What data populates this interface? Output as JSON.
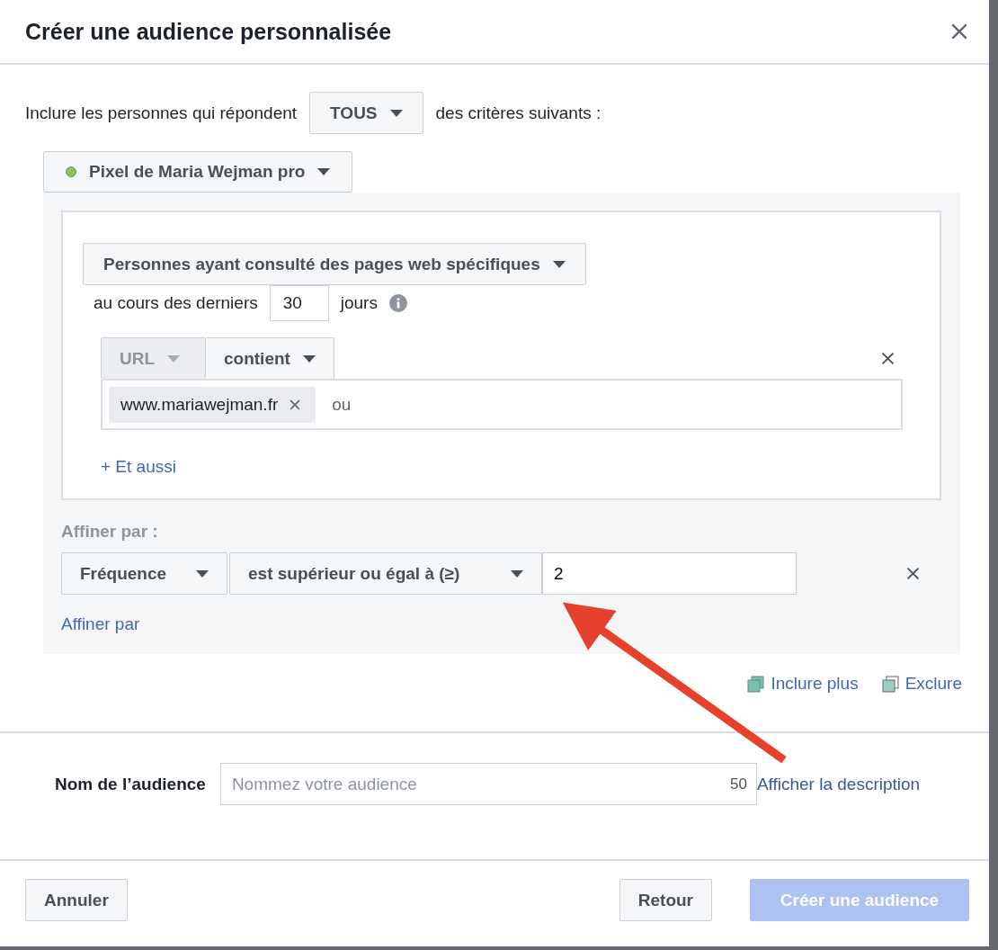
{
  "dialog": {
    "title": "Créer une audience personnalisée"
  },
  "match_rule": {
    "prefix": "Inclure les personnes qui répondent",
    "value": "TOUS",
    "suffix": "des critères suivants :"
  },
  "source": {
    "label": "Pixel de Maria Wejman pro",
    "active": true
  },
  "rule": {
    "event": "Personnes ayant consulté des pages web spécifiques",
    "period_prefix": "au cours des derniers",
    "days": "30",
    "period_suffix": "jours",
    "conditions": [
      {
        "field": "URL",
        "field_disabled": true,
        "operator": "contient",
        "tags": [
          "www.mariawejman.fr"
        ],
        "placeholder": "ou"
      }
    ],
    "add_link": "+ Et aussi"
  },
  "refine": {
    "heading": "Affiner par :",
    "filters": [
      {
        "metric": "Fréquence",
        "operator": "est supérieur ou égal à (≥)",
        "value": "2"
      }
    ],
    "add_link": "Affiner par"
  },
  "actions": [
    {
      "label": "Inclure plus",
      "kind": "include"
    },
    {
      "label": "Exclure",
      "kind": "exclude"
    }
  ],
  "name_field": {
    "label": "Nom de l’audience",
    "placeholder": "Nommez votre audience",
    "counter": "50",
    "link": "Afficher la description"
  },
  "footer": {
    "buttons": [
      {
        "label": "Annuler",
        "kind": "cancel",
        "disabled": false
      },
      {
        "label": "Retour",
        "kind": "back",
        "disabled": false
      },
      {
        "label": "Créer une audience",
        "kind": "primary",
        "disabled": true
      }
    ]
  }
}
